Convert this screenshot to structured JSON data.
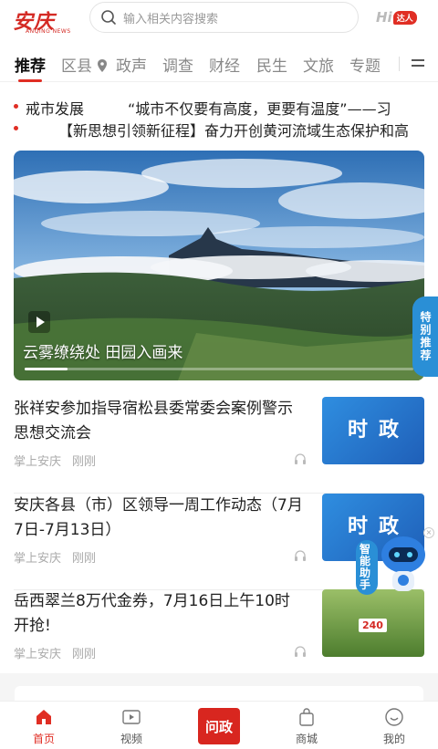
{
  "header": {
    "logo_text": "安庆",
    "logo_sub": "ANQING NEWS",
    "search_placeholder": "输入相关内容搜索",
    "hi_label": "Hi",
    "hi_badge": "达人"
  },
  "tabs": [
    {
      "label": "推荐",
      "active": true
    },
    {
      "label": "区县"
    },
    {
      "label": "政声"
    },
    {
      "label": "调查"
    },
    {
      "label": "财经"
    },
    {
      "label": "民生"
    },
    {
      "label": "文旅"
    },
    {
      "label": "专题"
    }
  ],
  "tickers": [
    "戒市发展　　　“城市不仅要有高度，更要有温度”——习",
    "【新思想引领新征程】奋力开创黄河流域生态保护和高"
  ],
  "hero": {
    "caption": "云雾缭绕处 田园入画来",
    "progress_fraction": 0.11
  },
  "special_recommend": "特别推荐",
  "news": [
    {
      "title": "张祥安参加指导宿松县委常委会案例警示思想交流会",
      "source": "掌上安庆",
      "time": "刚刚",
      "thumb_label": "时政"
    },
    {
      "title": "安庆各县（市）区领导一周工作动态（7月7日-7月13日）",
      "source": "掌上安庆",
      "time": "刚刚",
      "thumb_label": "时政"
    },
    {
      "title": "岳西翠兰8万代金券，7月16日上午10时开抢!",
      "source": "掌上安庆",
      "time": "刚刚",
      "thumb_label": "240"
    }
  ],
  "assistant": {
    "label": "智能助手",
    "close": "×"
  },
  "nav": [
    {
      "label": "首页",
      "active": true
    },
    {
      "label": "视频"
    },
    {
      "label": "问政"
    },
    {
      "label": "商城"
    },
    {
      "label": "我的"
    }
  ],
  "colors": {
    "brand_red": "#e02e24",
    "special_blue": "#2a8fd6"
  }
}
